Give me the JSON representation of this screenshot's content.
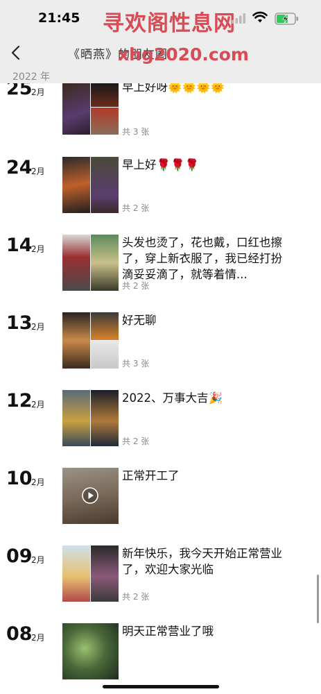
{
  "status": {
    "time": "21:45"
  },
  "watermark": {
    "line1": "寻欢阁性息网",
    "line2": "xhg2020.com"
  },
  "nav": {
    "title": "《晒燕》的朋友圈"
  },
  "year": "2022 年",
  "posts": [
    {
      "day": "25",
      "month": "2月",
      "text": "早上好呀🌞🌞🌞🌞",
      "count": "共 3 张"
    },
    {
      "day": "24",
      "month": "2月",
      "text": "早上好🌹🌹🌹",
      "count": "共 2 张"
    },
    {
      "day": "14",
      "month": "2月",
      "text": "头发也烫了，花也戴，口红也擦了，穿上新衣服了，我已经打扮滴妥妥滴了，就等着情...",
      "count": "共 2 张"
    },
    {
      "day": "13",
      "month": "2月",
      "text": "好无聊",
      "count": "共 3 张"
    },
    {
      "day": "12",
      "month": "2月",
      "text": "2022、万事大吉🎉",
      "count": "共 2 张"
    },
    {
      "day": "10",
      "month": "2月",
      "text": "正常开工了",
      "count": ""
    },
    {
      "day": "09",
      "month": "2月",
      "text": "新年快乐，我今天开始正常营业了，欢迎大家光临",
      "count": "共 2 张"
    },
    {
      "day": "08",
      "month": "2月",
      "text": "明天正常营业了哦",
      "count": ""
    }
  ],
  "icons": {
    "back": "chevron-left-icon",
    "signal": "signal-icon",
    "wifi": "wifi-icon",
    "battery": "battery-charging-icon",
    "play": "play-icon"
  },
  "colors": {
    "watermark": "#d94b55",
    "header_bg": "#ededed",
    "battery": "#34c759"
  }
}
